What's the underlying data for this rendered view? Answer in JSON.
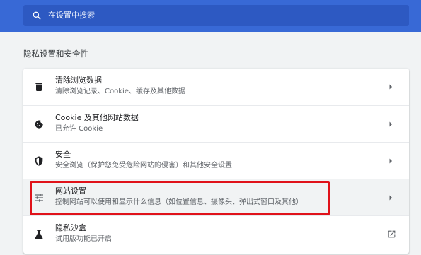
{
  "search": {
    "placeholder": "在设置中搜索"
  },
  "section": {
    "title": "隐私设置和安全性"
  },
  "rows": [
    {
      "title": "清除浏览数据",
      "subtitle": "清除浏览记录、Cookie、缓存及其他数据",
      "icon": "trash-icon",
      "action": "chevron-right-icon"
    },
    {
      "title": "Cookie 及其他网站数据",
      "subtitle": "已允许 Cookie",
      "icon": "cookie-icon",
      "action": "chevron-right-icon"
    },
    {
      "title": "安全",
      "subtitle": "安全浏览（保护您免受危险网站的侵害）和其他安全设置",
      "icon": "shield-icon",
      "action": "chevron-right-icon"
    },
    {
      "title": "网站设置",
      "subtitle": "控制网站可以使用和显示什么信息（如位置信息、摄像头、弹出式窗口及其他）",
      "icon": "tune-icon",
      "action": "chevron-right-icon",
      "highlighted": true
    },
    {
      "title": "隐私沙盒",
      "subtitle": "试用版功能已开启",
      "icon": "flask-icon",
      "action": "open-in-new-icon"
    }
  ],
  "colors": {
    "header": "#3869d6",
    "search_field": "#2d59c2",
    "annotation": "#e0121a",
    "background": "#f1f3f4"
  }
}
